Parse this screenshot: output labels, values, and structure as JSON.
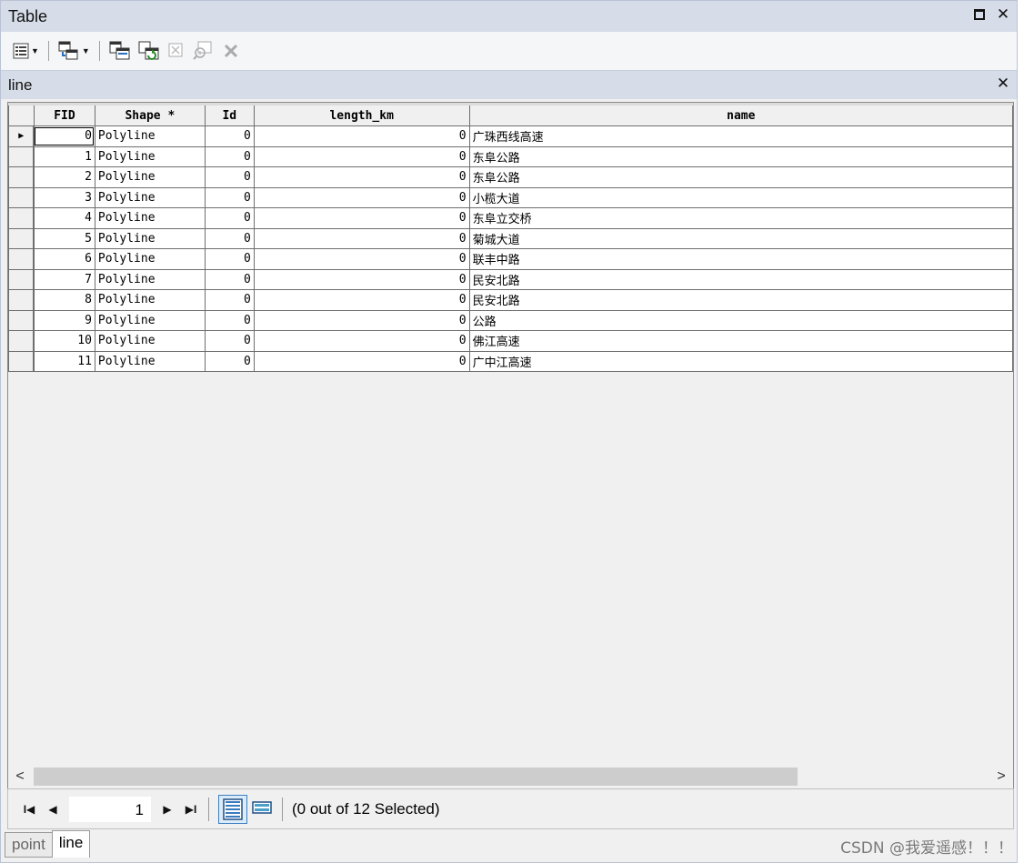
{
  "window": {
    "title": "Table"
  },
  "toolbar": {
    "icons": [
      "table-options-icon",
      "related-tables-icon",
      "select-by-attributes-icon",
      "switch-selection-icon",
      "clear-selection-icon",
      "zoom-to-selected-icon",
      "delete-selected-icon"
    ]
  },
  "table_tab": {
    "name": "line"
  },
  "grid": {
    "columns": [
      "FID",
      "Shape *",
      "Id",
      "length_km",
      "name"
    ],
    "rows": [
      {
        "fid": "0",
        "shape": "Polyline",
        "id": "0",
        "length_km": "0",
        "name": "广珠西线高速"
      },
      {
        "fid": "1",
        "shape": "Polyline",
        "id": "0",
        "length_km": "0",
        "name": "东阜公路"
      },
      {
        "fid": "2",
        "shape": "Polyline",
        "id": "0",
        "length_km": "0",
        "name": "东阜公路"
      },
      {
        "fid": "3",
        "shape": "Polyline",
        "id": "0",
        "length_km": "0",
        "name": "小榄大道"
      },
      {
        "fid": "4",
        "shape": "Polyline",
        "id": "0",
        "length_km": "0",
        "name": "东阜立交桥"
      },
      {
        "fid": "5",
        "shape": "Polyline",
        "id": "0",
        "length_km": "0",
        "name": "菊城大道"
      },
      {
        "fid": "6",
        "shape": "Polyline",
        "id": "0",
        "length_km": "0",
        "name": "联丰中路"
      },
      {
        "fid": "7",
        "shape": "Polyline",
        "id": "0",
        "length_km": "0",
        "name": "民安北路"
      },
      {
        "fid": "8",
        "shape": "Polyline",
        "id": "0",
        "length_km": "0",
        "name": "民安北路"
      },
      {
        "fid": "9",
        "shape": "Polyline",
        "id": "0",
        "length_km": "0",
        "name": "公路"
      },
      {
        "fid": "10",
        "shape": "Polyline",
        "id": "0",
        "length_km": "0",
        "name": "佛江高速"
      },
      {
        "fid": "11",
        "shape": "Polyline",
        "id": "0",
        "length_km": "0",
        "name": "广中江高速"
      }
    ]
  },
  "status": {
    "current_record": "1",
    "selection": "(0 out of 12 Selected)"
  },
  "tabs": [
    {
      "label": "point",
      "active": false
    },
    {
      "label": "line",
      "active": true
    }
  ],
  "watermark": "CSDN @我爱遥感！！！",
  "colors": {
    "title_bg": "#d6dde8",
    "grid_bg": "#f0f0f0",
    "active_view": "#3d7fc1"
  }
}
